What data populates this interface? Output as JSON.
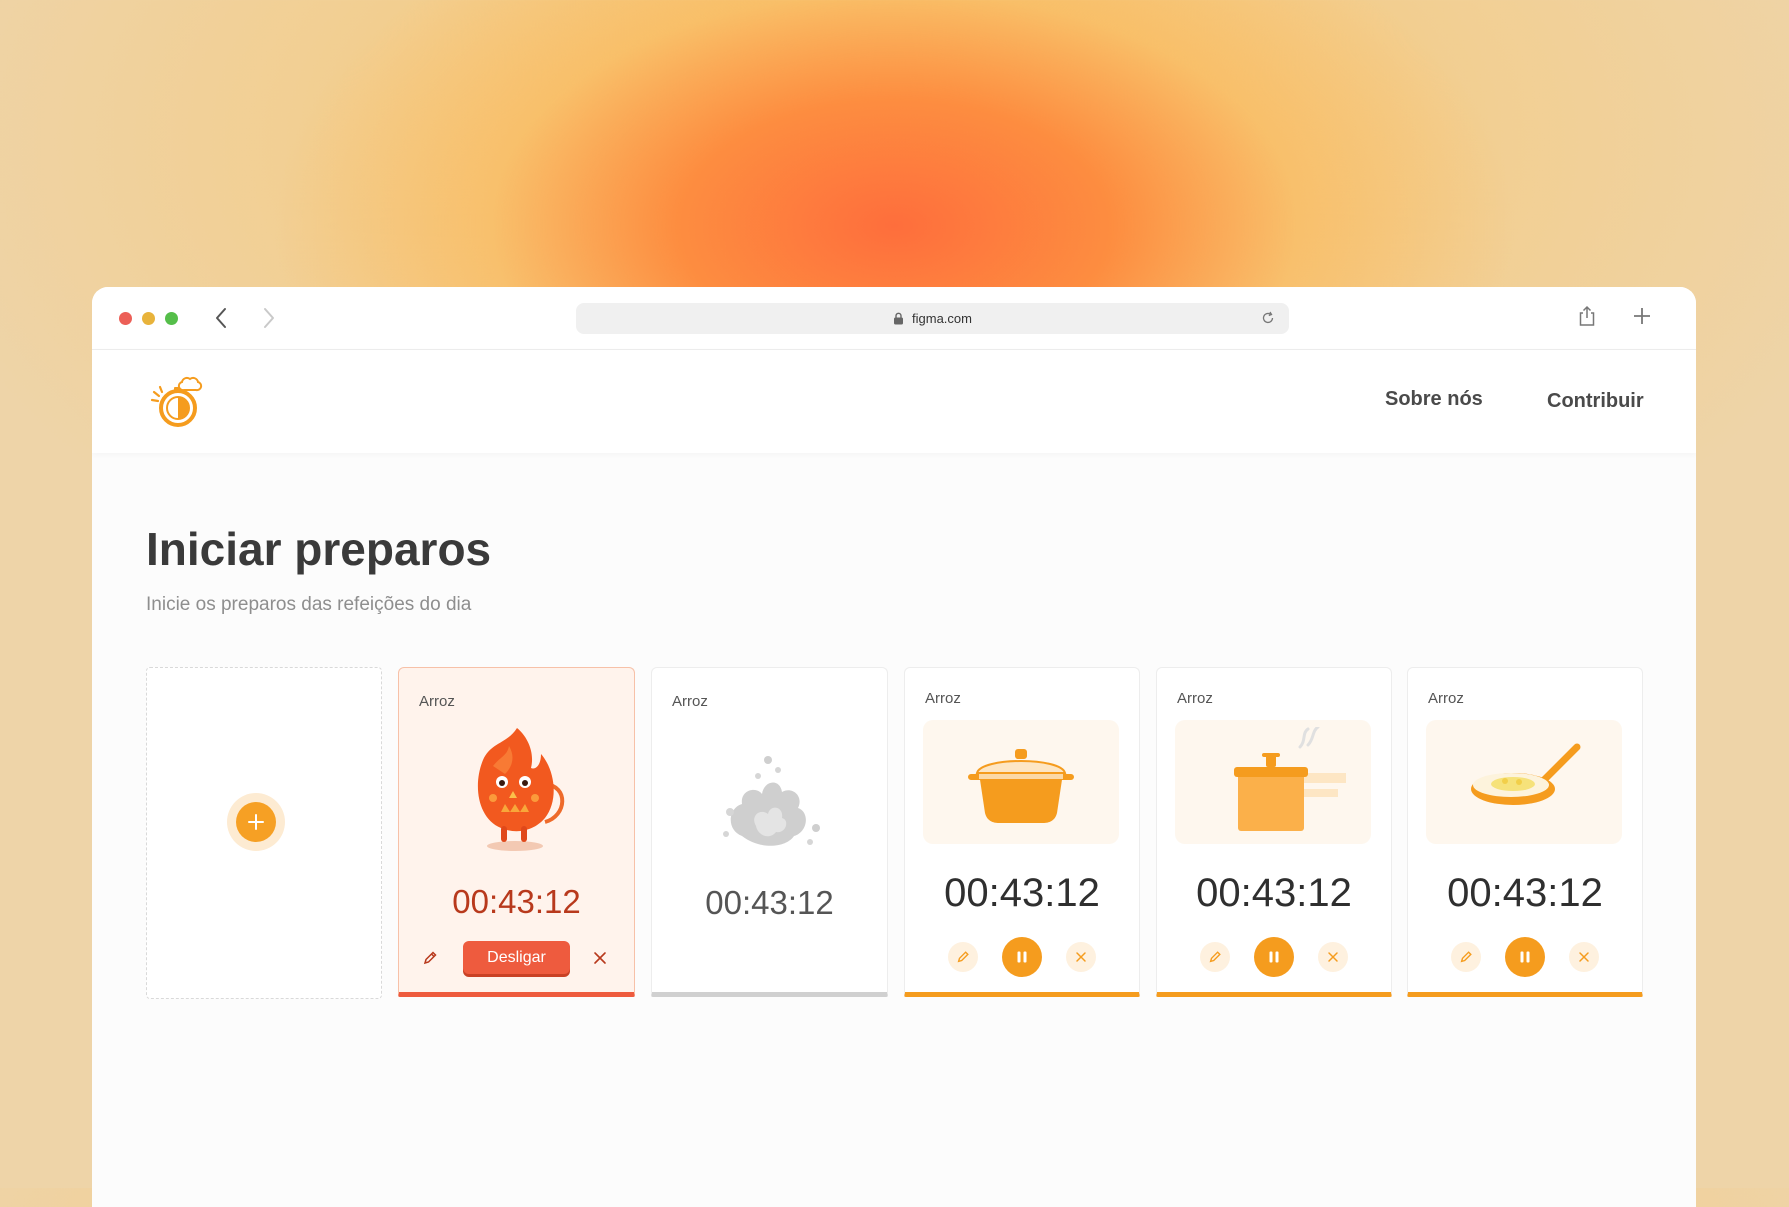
{
  "browser": {
    "url": "figma.com"
  },
  "header": {
    "nav": [
      "Sobre nós",
      "Contribuir"
    ]
  },
  "page": {
    "title": "Iniciar preparos",
    "subtitle": "Inicie os preparos das refeições do dia"
  },
  "cards": [
    {
      "label": "Arroz",
      "time": "00:43:12",
      "state": "fire",
      "action": "Desligar"
    },
    {
      "label": "Arroz",
      "time": "00:43:12",
      "state": "smoke"
    },
    {
      "label": "Arroz",
      "time": "00:43:12",
      "state": "cooking",
      "icon": "pot-icon"
    },
    {
      "label": "Arroz",
      "time": "00:43:12",
      "state": "cooking",
      "icon": "pressure-cooker-icon"
    },
    {
      "label": "Arroz",
      "time": "00:43:12",
      "state": "cooking",
      "icon": "frying-pan-icon"
    }
  ],
  "colors": {
    "accent": "#f59c1e",
    "danger": "#ee5b3e",
    "done": "#d0d0d0"
  }
}
